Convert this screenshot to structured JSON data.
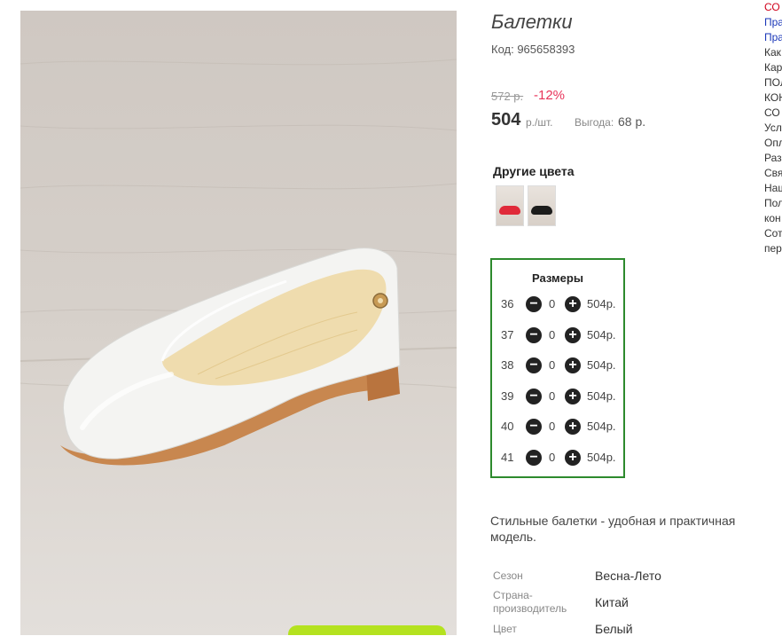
{
  "product": {
    "title": "Балетки",
    "code": "Код: 965658393",
    "old_price": "572 р.",
    "discount": "-12%",
    "price": "504",
    "unit": "р./шт.",
    "savings_label": "Выгода:",
    "savings_value": "68 р."
  },
  "colors": {
    "title": "Другие цвета",
    "swatches": [
      {
        "name": "red",
        "color": "#e02a3a"
      },
      {
        "name": "black",
        "color": "#1c1c1c"
      }
    ]
  },
  "sizes": {
    "title": "Размеры",
    "rows": [
      {
        "size": "36",
        "qty": "0",
        "price": "504р."
      },
      {
        "size": "37",
        "qty": "0",
        "price": "504р."
      },
      {
        "size": "38",
        "qty": "0",
        "price": "504р."
      },
      {
        "size": "39",
        "qty": "0",
        "price": "504р."
      },
      {
        "size": "40",
        "qty": "0",
        "price": "504р."
      },
      {
        "size": "41",
        "qty": "0",
        "price": "504р."
      }
    ]
  },
  "description": "Стильные балетки - удобная и практичная модель.",
  "specs": [
    {
      "label": "Сезон",
      "value": "Весна-Лето"
    },
    {
      "label": "Страна-\nпроизводитель",
      "value": "Китай"
    },
    {
      "label": "Цвет",
      "value": "Белый"
    }
  ],
  "sidebar": [
    {
      "text": "СО",
      "color": "#d0021b"
    },
    {
      "text": "Пра",
      "color": "#1a37b8"
    },
    {
      "text": "Пра",
      "color": "#1a37b8"
    },
    {
      "text": "Как",
      "color": "#333333"
    },
    {
      "text": "Кар",
      "color": "#333333"
    },
    {
      "text": "ПОЛ",
      "color": "#333333"
    },
    {
      "text": "КОН",
      "color": "#333333"
    },
    {
      "text": "СО",
      "color": "#333333"
    },
    {
      "text": "Усл",
      "color": "#333333"
    },
    {
      "text": "Опл",
      "color": "#333333"
    },
    {
      "text": "Раз",
      "color": "#333333"
    },
    {
      "text": "Свя",
      "color": "#333333"
    },
    {
      "text": "Наш",
      "color": "#333333"
    },
    {
      "text": "Пол",
      "color": "#333333"
    },
    {
      "text": "кон",
      "color": "#333333"
    },
    {
      "text": "Сот",
      "color": "#333333"
    },
    {
      "text": "пер",
      "color": "#333333"
    }
  ]
}
